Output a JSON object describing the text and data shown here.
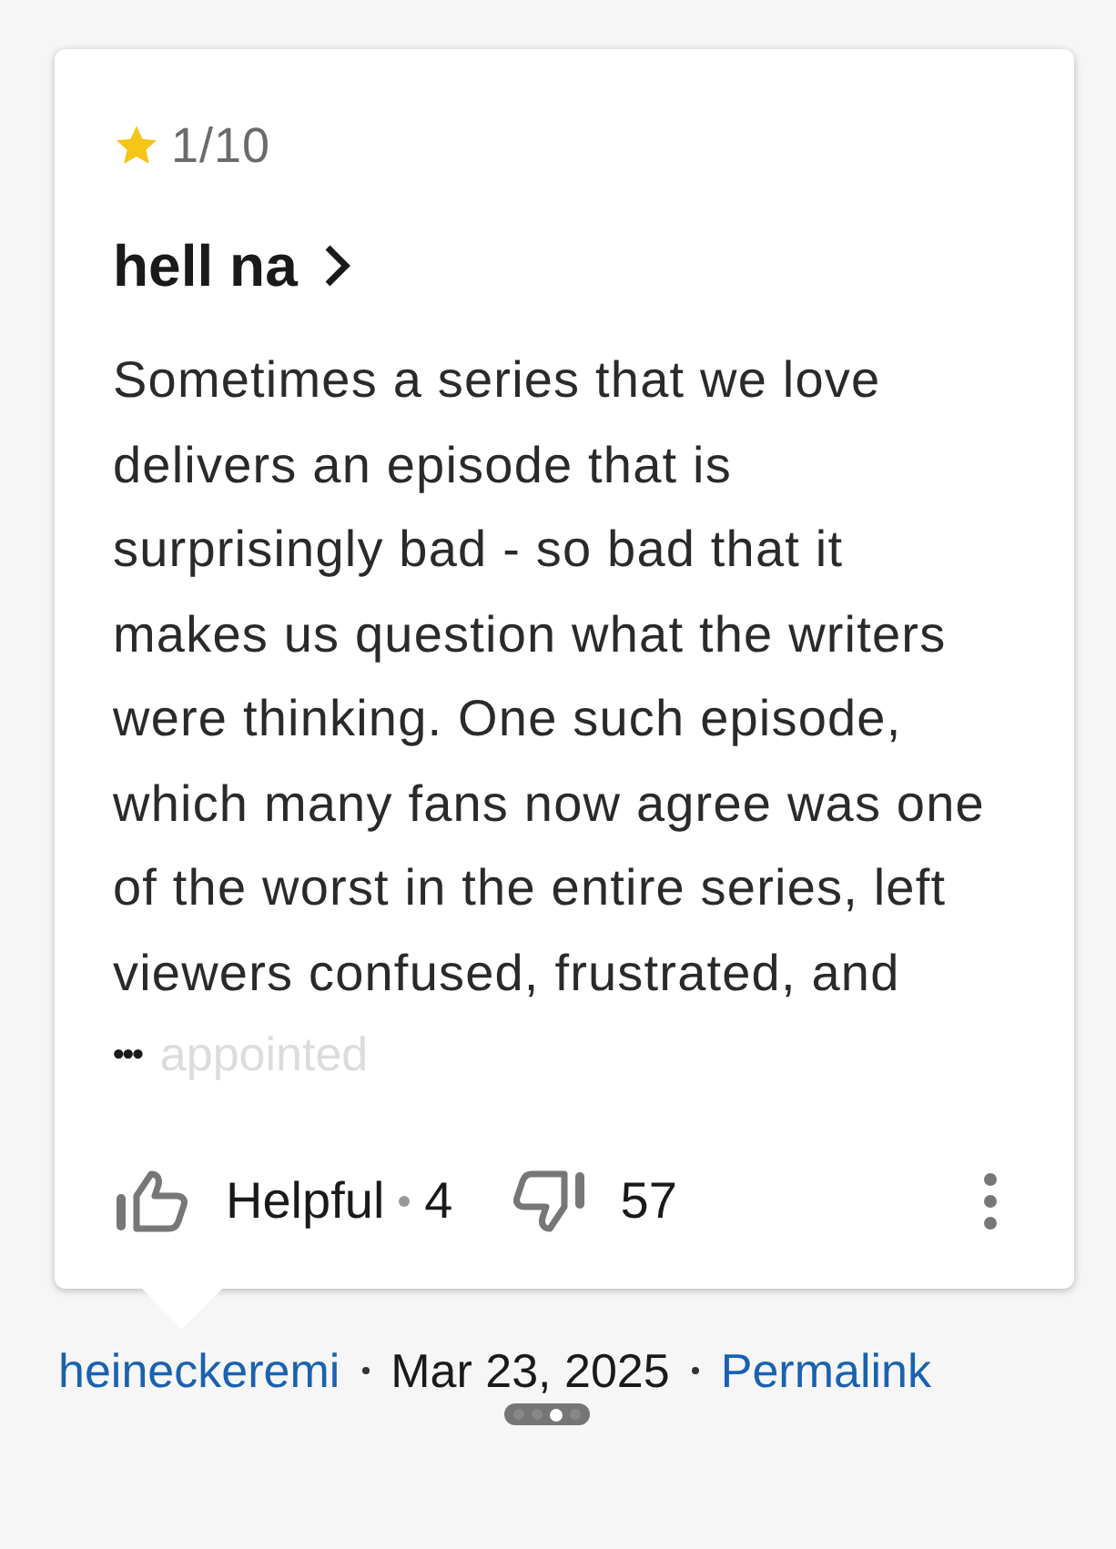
{
  "review": {
    "rating": "1/10",
    "title": "hell na",
    "body": "Sometimes a series that we love delivers an episode that is surprisingly bad - so bad that it makes us question what the writers were thinking. One such episode, which many fans now agree was one of the worst in the entire series, left viewers confused, frustrated, and",
    "more": "•••",
    "faded_text": "appointed",
    "helpful_label": "Helpful",
    "helpful_count": "4",
    "unhelpful_count": "57"
  },
  "byline": {
    "author": "heineckeremi",
    "date": "Mar 23, 2025",
    "permalink": "Permalink"
  },
  "pager": [
    {
      "selected": false
    },
    {
      "selected": false
    },
    {
      "selected": true
    },
    {
      "selected": false
    }
  ]
}
